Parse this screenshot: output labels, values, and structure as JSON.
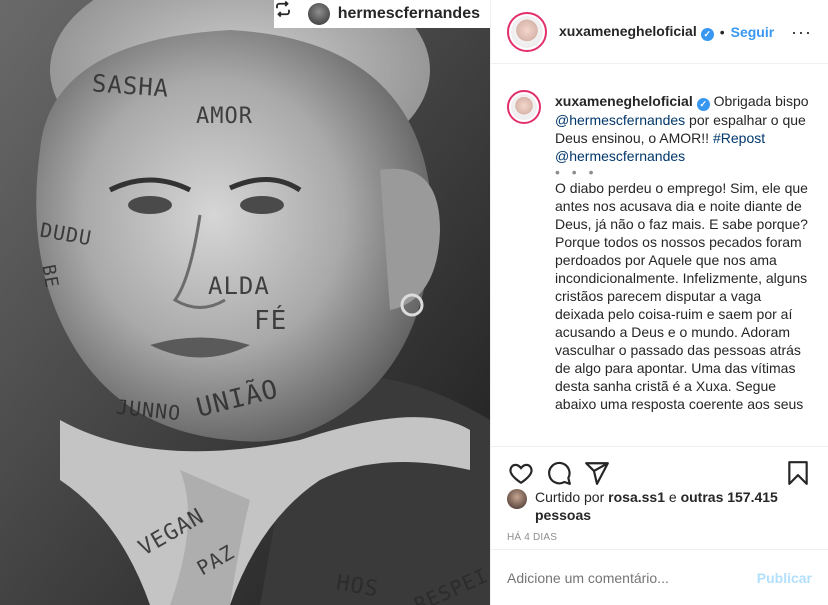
{
  "photo": {
    "repost_icon": "repost-icon",
    "repost_user": "hermescfernandes",
    "face_words": [
      "SASHA",
      "AMOR",
      "DUDU",
      "BE",
      "ALDA",
      "FÉ",
      "JUNNO",
      "UNIÃO",
      "VEGAN",
      "PAZ",
      "HOS",
      "RESPEI"
    ]
  },
  "header": {
    "username": "xuxamenegheloficial",
    "verified_icon": "verified-badge-icon",
    "separator": "•",
    "follow_label": "Seguir",
    "more_label": "···"
  },
  "caption": {
    "username": "xuxamenegheloficial",
    "intro_1": "Obrigada bispo ",
    "mention_1": "@hermescfernandes",
    "intro_2": " por espalhar o que Deus ensinou, o AMOR!! ",
    "hashtag": "#Repost",
    "intro_3": " ",
    "mention_2": "@hermescfernandes",
    "dots": "• • •",
    "body": "O diabo perdeu o emprego! Sim, ele que antes nos acusava dia e noite diante de Deus, já não o faz mais. E sabe porque? Porque todos os nossos pecados foram perdoados por Aquele que nos ama incondicionalmente. Infelizmente, alguns cristãos parecem disputar a vaga deixada pelo coisa-ruim e saem por aí acusando a Deus e o mundo. Adoram vasculhar o passado das pessoas atrás de algo para apontar. Uma das vítimas desta sanha cristã é a Xuxa. Segue abaixo uma resposta coerente aos seus"
  },
  "actions": {
    "like_icon": "heart-icon",
    "comment_icon": "comment-icon",
    "share_icon": "share-icon",
    "save_icon": "bookmark-icon"
  },
  "likes": {
    "prefix": "Curtido por ",
    "user": "rosa.ss1",
    "middle": " e ",
    "others": "outras 157.415 pessoas"
  },
  "time_label": "HÁ 4 DIAS",
  "add_comment": {
    "placeholder": "Adicione um comentário...",
    "publish_label": "Publicar"
  },
  "colors": {
    "link": "#00376b",
    "accent": "#3897f0",
    "publish_disabled": "#b2dffc",
    "muted": "#8e8e8e"
  }
}
